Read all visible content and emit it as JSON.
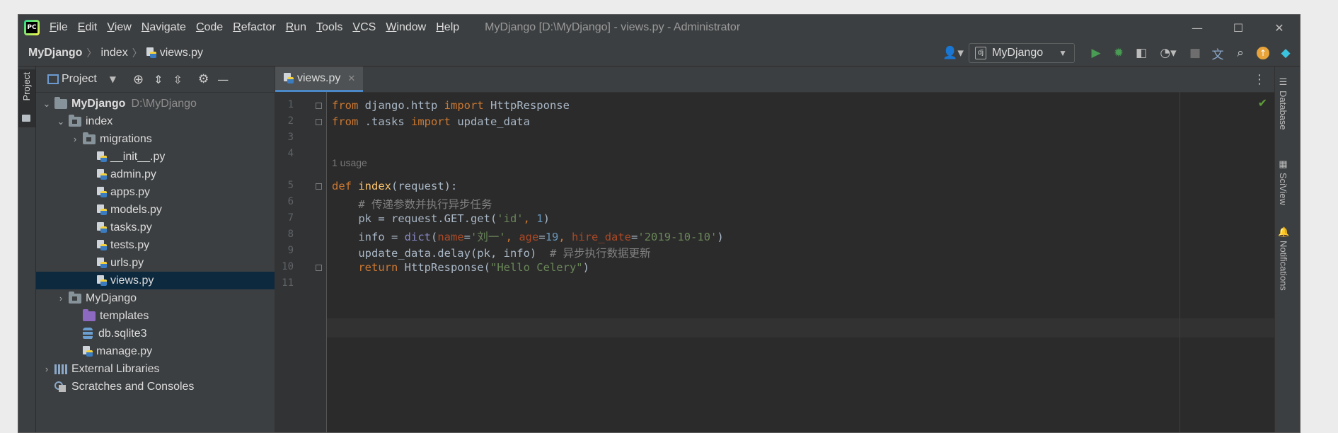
{
  "menu": [
    "File",
    "Edit",
    "View",
    "Navigate",
    "Code",
    "Refactor",
    "Run",
    "Tools",
    "VCS",
    "Window",
    "Help"
  ],
  "window_title": "MyDjango [D:\\MyDjango] - views.py - Administrator",
  "breadcrumb": [
    "MyDjango",
    "index",
    "views.py"
  ],
  "run_config": "MyDjango",
  "left_tool_tab": "Project",
  "project_panel": {
    "title": "Project",
    "tree": [
      {
        "label": "MyDjango",
        "extra": "D:\\MyDjango",
        "depth": 0,
        "type": "folder",
        "arrow": "open",
        "bold": true
      },
      {
        "label": "index",
        "depth": 1,
        "type": "folder",
        "arrow": "open"
      },
      {
        "label": "migrations",
        "depth": 2,
        "type": "folder",
        "arrow": "closed"
      },
      {
        "label": "__init__.py",
        "depth": 3,
        "type": "py"
      },
      {
        "label": "admin.py",
        "depth": 3,
        "type": "py"
      },
      {
        "label": "apps.py",
        "depth": 3,
        "type": "py"
      },
      {
        "label": "models.py",
        "depth": 3,
        "type": "py"
      },
      {
        "label": "tasks.py",
        "depth": 3,
        "type": "py"
      },
      {
        "label": "tests.py",
        "depth": 3,
        "type": "py"
      },
      {
        "label": "urls.py",
        "depth": 3,
        "type": "py"
      },
      {
        "label": "views.py",
        "depth": 3,
        "type": "py",
        "selected": true
      },
      {
        "label": "MyDjango",
        "depth": 1,
        "type": "folder",
        "arrow": "closed"
      },
      {
        "label": "templates",
        "depth": 2,
        "type": "folder-purple"
      },
      {
        "label": "db.sqlite3",
        "depth": 2,
        "type": "db"
      },
      {
        "label": "manage.py",
        "depth": 2,
        "type": "py"
      },
      {
        "label": "External Libraries",
        "depth": 0,
        "type": "lib",
        "arrow": "closed"
      },
      {
        "label": "Scratches and Consoles",
        "depth": 0,
        "type": "scratch"
      }
    ]
  },
  "editor": {
    "tab": "views.py",
    "usage_hint": "1 usage",
    "line_numbers": [
      "1",
      "2",
      "3",
      "4",
      "5",
      "6",
      "7",
      "8",
      "9",
      "10",
      "11"
    ],
    "lines": [
      [
        [
          "k",
          "from"
        ],
        [
          "t",
          " django.http "
        ],
        [
          "k",
          "import"
        ],
        [
          "t",
          " HttpResponse"
        ]
      ],
      [
        [
          "k",
          "from"
        ],
        [
          "t",
          " .tasks "
        ],
        [
          "k",
          "import"
        ],
        [
          "t",
          " update_data"
        ]
      ],
      [],
      [],
      [
        [
          "k",
          "def "
        ],
        [
          "f",
          "index"
        ],
        [
          "t",
          "(request):"
        ]
      ],
      [
        [
          "c",
          "    # 传递参数并执行异步任务"
        ]
      ],
      [
        [
          "t",
          "    pk = request.GET.get("
        ],
        [
          "s",
          "'id'"
        ],
        [
          "k",
          ", "
        ],
        [
          "n",
          "1"
        ],
        [
          "t",
          ")"
        ]
      ],
      [
        [
          "t",
          "    info = "
        ],
        [
          "bi",
          "dict"
        ],
        [
          "t",
          "("
        ],
        [
          "pn",
          "name"
        ],
        [
          "t",
          "="
        ],
        [
          "s",
          "'刘一'"
        ],
        [
          "k",
          ", "
        ],
        [
          "pn",
          "age"
        ],
        [
          "t",
          "="
        ],
        [
          "n",
          "19"
        ],
        [
          "k",
          ", "
        ],
        [
          "pn",
          "hire_date"
        ],
        [
          "t",
          "="
        ],
        [
          "s",
          "'2019-10-10'"
        ],
        [
          "t",
          ")"
        ]
      ],
      [
        [
          "t",
          "    update_data.delay(pk, info)  "
        ],
        [
          "c",
          "# 异步执行数据更新"
        ]
      ],
      [
        [
          "k",
          "    return "
        ],
        [
          "t",
          "HttpResponse("
        ],
        [
          "s",
          "\"Hello Celery\""
        ],
        [
          "t",
          ")"
        ]
      ],
      []
    ]
  },
  "right_tabs": [
    "Database",
    "SciView",
    "Notifications"
  ]
}
